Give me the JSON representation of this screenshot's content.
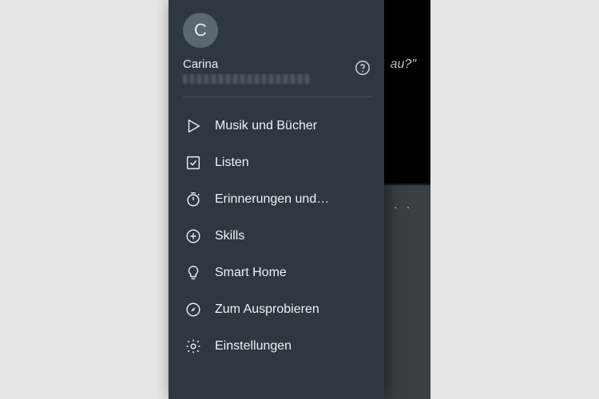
{
  "background": {
    "partial_text": "au?\"",
    "dots": ". ."
  },
  "drawer": {
    "avatar_initial": "C",
    "user_name": "Carina",
    "menu": [
      {
        "label": "Musik und Bücher"
      },
      {
        "label": "Listen"
      },
      {
        "label": "Erinnerungen und…"
      },
      {
        "label": "Skills"
      },
      {
        "label": "Smart Home"
      },
      {
        "label": "Zum Ausprobieren"
      },
      {
        "label": "Einstellungen"
      }
    ]
  }
}
